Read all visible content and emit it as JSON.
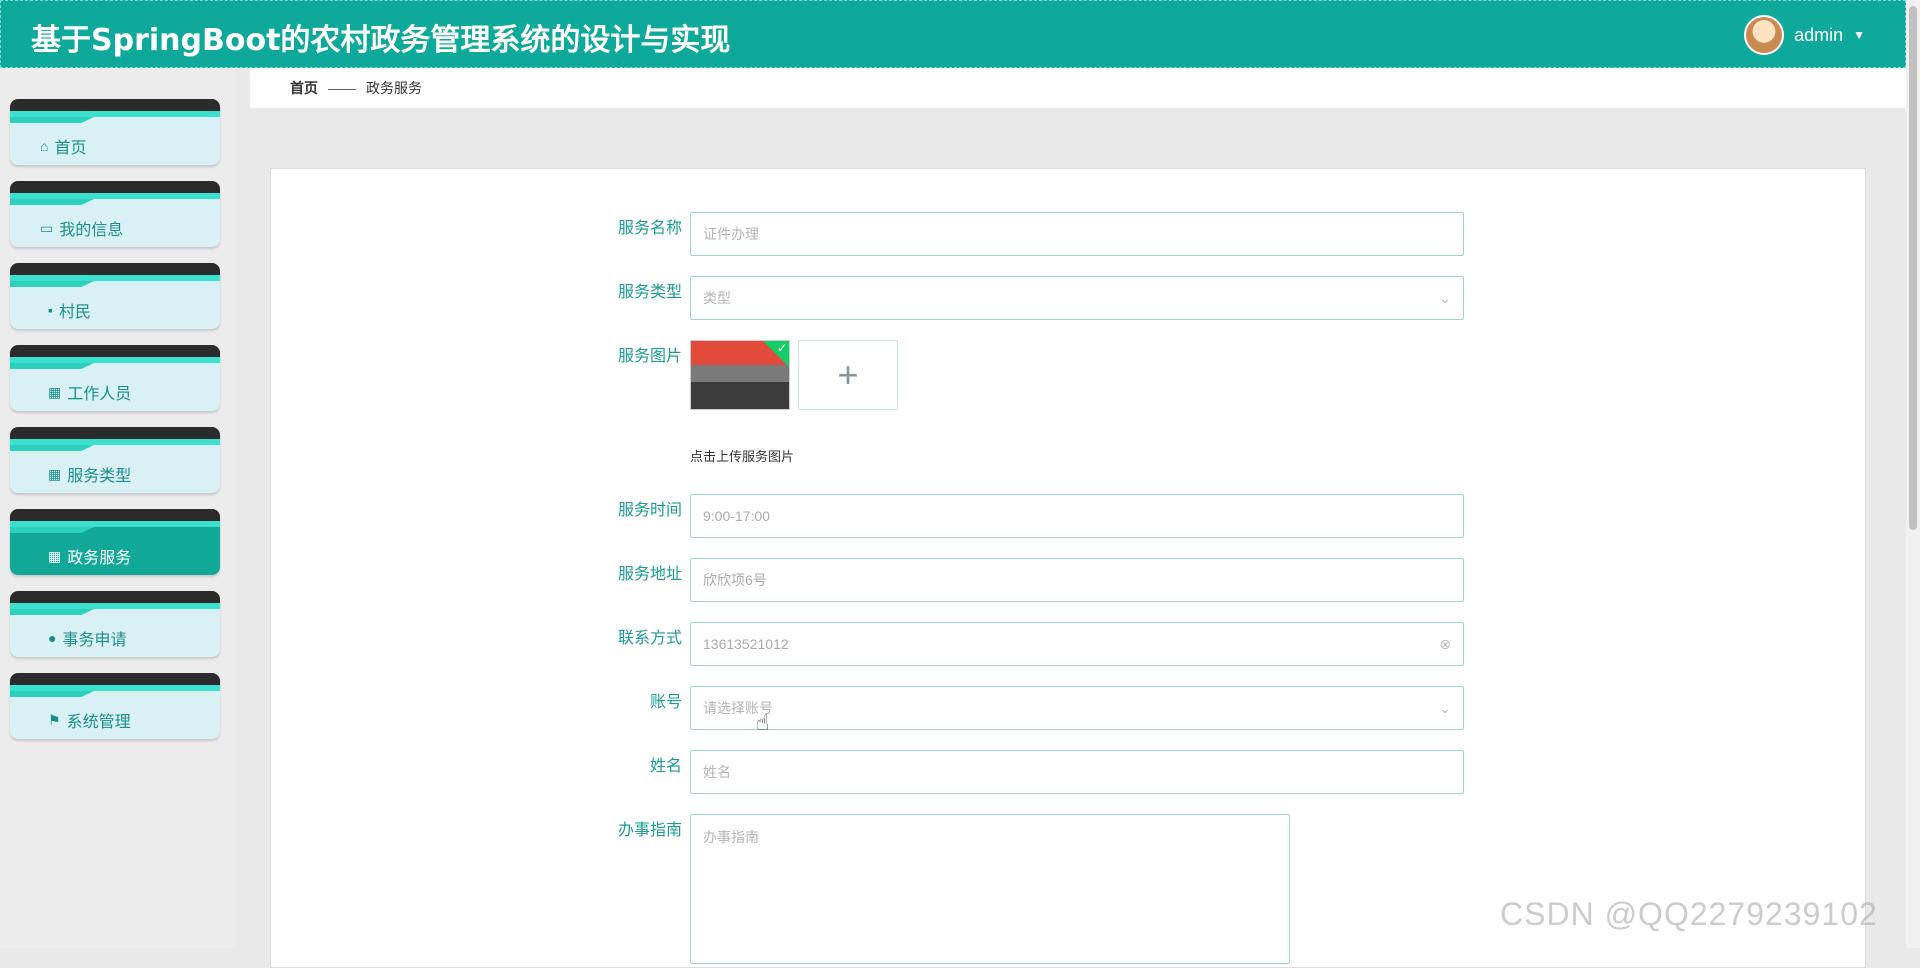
{
  "header": {
    "title": "基于SpringBoot的农村政务管理系统的设计与实现",
    "username": "admin"
  },
  "sidebar": {
    "items": [
      {
        "label": "首页",
        "icon": "home-icon"
      },
      {
        "label": "我的信息",
        "icon": "card-icon"
      },
      {
        "label": "村民",
        "icon": "chat-icon"
      },
      {
        "label": "工作人员",
        "icon": "grid-icon"
      },
      {
        "label": "服务类型",
        "icon": "grid-icon"
      },
      {
        "label": "政务服务",
        "icon": "grid-icon",
        "active": true
      },
      {
        "label": "事务申请",
        "icon": "pin-icon"
      },
      {
        "label": "系统管理",
        "icon": "flag-icon"
      }
    ]
  },
  "breadcrumb": {
    "home": "首页",
    "sep": "——",
    "current": "政务服务"
  },
  "form": {
    "service_name": {
      "label": "服务名称",
      "placeholder": "证件办理"
    },
    "service_type": {
      "label": "服务类型",
      "placeholder": "类型"
    },
    "service_image": {
      "label": "服务图片",
      "hint": "点击上传服务图片"
    },
    "service_time": {
      "label": "服务时间",
      "value": "9:00-17:00"
    },
    "service_address": {
      "label": "服务地址",
      "value": "欣欣项6号"
    },
    "contact": {
      "label": "联系方式",
      "value": "13613521012"
    },
    "account": {
      "label": "账号",
      "placeholder": "请选择账号"
    },
    "name": {
      "label": "姓名",
      "placeholder": "姓名"
    },
    "guide": {
      "label": "办事指南",
      "placeholder": "办事指南"
    }
  },
  "watermark": "CSDN @QQ2279239102"
}
